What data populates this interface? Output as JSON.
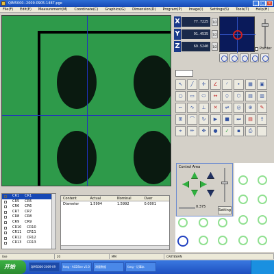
{
  "window": {
    "title": "QIM5000--2009-0905-1487.pge"
  },
  "menu": [
    "File(F)",
    "Edit(E)",
    "Measurement(M)",
    "Coordinate(C)",
    "Graphics(G)",
    "Dimension(D)",
    "Program(P)",
    "Image(I)",
    "Settings(S)",
    "Tools(T)",
    "Help(H)"
  ],
  "dro": {
    "x": {
      "label": "X",
      "value": "77.7225"
    },
    "y": {
      "label": "Y",
      "value": "91.4535"
    },
    "z": {
      "label": "Z",
      "value": "69.5240"
    }
  },
  "pointer_label": "Pointer",
  "control_area": {
    "title": "Control Area",
    "speed_value": "0.375",
    "setting_label": "Setting"
  },
  "tree": [
    {
      "a": "CR1",
      "b": "CR1"
    },
    {
      "a": "CR5",
      "b": "CR5"
    },
    {
      "a": "CR6",
      "b": "CR6"
    },
    {
      "a": "CR7",
      "b": "CR7"
    },
    {
      "a": "CR8",
      "b": "CR8"
    },
    {
      "a": "CR9",
      "b": "CR9"
    },
    {
      "a": "CR10",
      "b": "CR10"
    },
    {
      "a": "CR11",
      "b": "CR11"
    },
    {
      "a": "CR12",
      "b": "CR12"
    },
    {
      "a": "CR13",
      "b": "CR13"
    }
  ],
  "results": {
    "headers": [
      "Content",
      "Actual",
      "Nominal",
      "Over"
    ],
    "rows": [
      [
        "Diameter",
        "1.5994",
        "1.5992",
        "0.0001"
      ]
    ]
  },
  "status": [
    "Use",
    "20",
    "MM",
    "CARTESIAN"
  ],
  "taskbar": {
    "start": "开始",
    "tasks": [
      "QIM5000-2009-09",
      "fang - ACDSee v5.0",
      "测量数据",
      "fang - 记事本"
    ]
  }
}
